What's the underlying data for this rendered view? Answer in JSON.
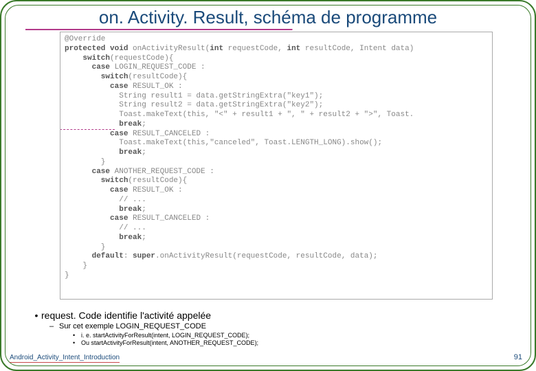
{
  "title": "on. Activity. Result, schéma de programme",
  "code": {
    "l1": "@Override",
    "l2a": "protected void ",
    "l2b": "onActivityResult(",
    "l2c": "int",
    "l2d": " requestCode, ",
    "l2e": "int",
    "l2f": " resultCode, Intent data)",
    "l3a": "    switch",
    "l3b": "(requestCode){",
    "l4a": "      case",
    "l4b": " LOGIN_REQUEST_CODE :",
    "l5a": "        switch",
    "l5b": "(resultCode){",
    "l6a": "          case",
    "l6b": " RESULT_OK :",
    "l7": "            String result1 = data.getStringExtra(\"key1\");",
    "l8": "            String result2 = data.getStringExtra(\"key2\");",
    "l9": "            Toast.makeText(this, \"<\" + result1 + \", \" + result2 + \">\", Toast.",
    "l10a": "            break",
    "l10b": ";",
    "l11a": "          case",
    "l11b": " RESULT_CANCELED :",
    "l12": "            Toast.makeText(this,\"canceled\", Toast.LENGTH_LONG).show();",
    "l13a": "            break",
    "l13b": ";",
    "l14": "        }",
    "l15a": "      case",
    "l15b": " ANOTHER_REQUEST_CODE :",
    "l16a": "        switch",
    "l16b": "(resultCode){",
    "l17a": "          case",
    "l17b": " RESULT_OK :",
    "l18": "            // ...",
    "l19a": "            break",
    "l19b": ";",
    "l20a": "          case",
    "l20b": " RESULT_CANCELED :",
    "l21": "            // ...",
    "l22a": "            break",
    "l22b": ";",
    "l23": "        }",
    "l24a": "      default",
    "l24b": ": ",
    "l24c": "super",
    "l24d": ".onActivityResult(requestCode, resultCode, data);",
    "l25": "    }",
    "l26": "}"
  },
  "bullets": {
    "b1": "request. Code identifie l'activité appelée",
    "b2": "Sur cet exemple LOGIN_REQUEST_CODE",
    "b3a": "i. e. startActivityForResult(intent, LOGIN_REQUEST_CODE);",
    "b3b": "Ou startActivityForResult(intent, ANOTHER_REQUEST_CODE);"
  },
  "footer": {
    "left": "Android_Activity_Intent_Introduction",
    "page": "91"
  }
}
